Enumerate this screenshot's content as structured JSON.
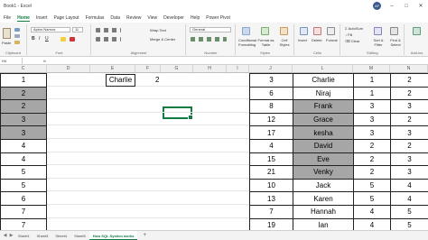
{
  "titlebar": {
    "title": "Book1 - Excel",
    "avatar": "AF"
  },
  "tabs": [
    "File",
    "Home",
    "Insert",
    "Page Layout",
    "Formulas",
    "Data",
    "Review",
    "View",
    "Developer",
    "Help",
    "Power Pivot"
  ],
  "ribbon": {
    "clipboard": {
      "paste": "Paste",
      "label": "Clipboard"
    },
    "font": {
      "name": "Aptos Narrow",
      "size": "11",
      "label": "Font"
    },
    "alignment": {
      "wrap": "Wrap Text",
      "merge": "Merge & Center",
      "label": "Alignment"
    },
    "number": {
      "format": "General",
      "label": "Number"
    },
    "styles": {
      "cond": "Conditional Formatting",
      "table": "Format as Table",
      "cell": "Cell Styles",
      "label": "Styles"
    },
    "cells": {
      "insert": "Insert",
      "delete": "Delete",
      "format": "Format",
      "label": "Cells"
    },
    "editing": {
      "autosum": "AutoSum",
      "fill": "Fill",
      "clear": "Clear",
      "sort": "Sort & Filter",
      "find": "Find & Select",
      "label": "Editing"
    },
    "addins": {
      "label": "Add-ins"
    }
  },
  "formula_bar": {
    "name_box": "H4",
    "fx": "fx"
  },
  "columns_left": [
    "C",
    "D",
    "E",
    "F",
    "G",
    "H",
    "I"
  ],
  "columns_right": [
    "J",
    "L",
    "M",
    "N"
  ],
  "left_col_values": [
    "1",
    "2",
    "2",
    "3",
    "3",
    "4",
    "4",
    "5",
    "5",
    "6",
    "7",
    "7"
  ],
  "left_gray_rows": [
    1,
    2,
    3,
    4
  ],
  "charlie_cell": "Charlie",
  "h_value": "2",
  "right_table": [
    [
      "3",
      "Charlie",
      "1",
      "2"
    ],
    [
      "6",
      "Niraj",
      "1",
      "2"
    ],
    [
      "8",
      "Frank",
      "3",
      "3"
    ],
    [
      "12",
      "Grace",
      "3",
      "2"
    ],
    [
      "17",
      "kesha",
      "3",
      "3"
    ],
    [
      "4",
      "David",
      "2",
      "2"
    ],
    [
      "15",
      "Eve",
      "2",
      "3"
    ],
    [
      "21",
      "Venky",
      "2",
      "3"
    ],
    [
      "10",
      "Jack",
      "5",
      "4"
    ],
    [
      "13",
      "Karen",
      "5",
      "4"
    ],
    [
      "7",
      "Hannah",
      "4",
      "5"
    ],
    [
      "19",
      "Ian",
      "4",
      "5"
    ]
  ],
  "right_gray_rows": [
    2,
    3,
    4,
    5,
    6,
    7
  ],
  "sheets": [
    "Sheet1",
    "Sheet3",
    "Sheet4",
    "Sheet5",
    "How SQL System works"
  ],
  "active_sheet": "How SQL System works"
}
